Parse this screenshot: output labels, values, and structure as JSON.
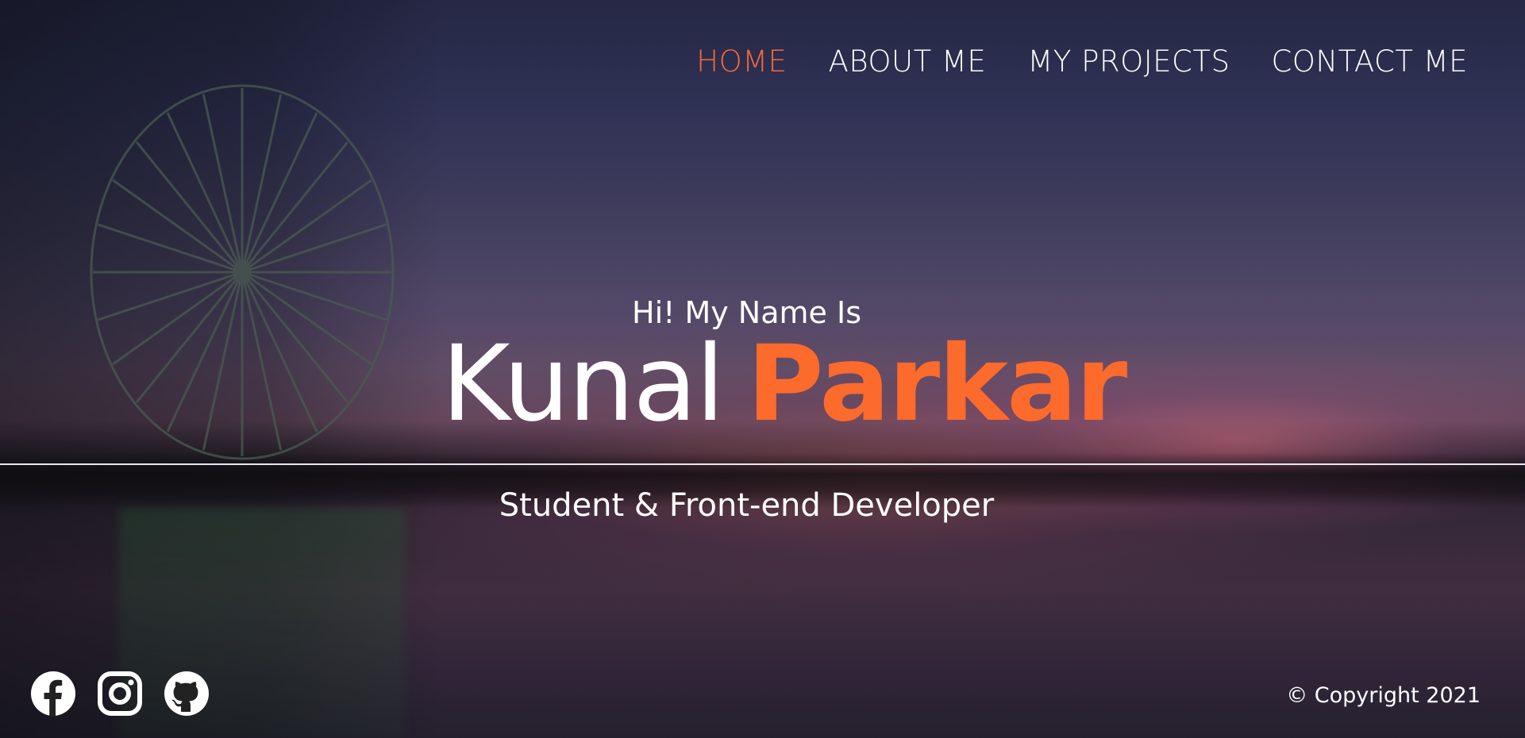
{
  "nav": {
    "items": [
      {
        "label": "HOME",
        "active": true
      },
      {
        "label": "ABOUT ME",
        "active": false
      },
      {
        "label": "MY PROJECTS",
        "active": false
      },
      {
        "label": "CONTACT ME",
        "active": false
      }
    ]
  },
  "hero": {
    "greeting": "Hi! My Name Is",
    "first_name": "Kunal",
    "last_name": "Parkar",
    "tagline": "Student & Front-end Developer"
  },
  "footer": {
    "social": [
      {
        "icon": "facebook-icon"
      },
      {
        "icon": "instagram-icon"
      },
      {
        "icon": "github-icon"
      }
    ],
    "copyright": "© Copyright 2021"
  },
  "colors": {
    "accent": "#fc6a2c",
    "nav_active": "#f26b3a",
    "text": "#ffffff"
  }
}
